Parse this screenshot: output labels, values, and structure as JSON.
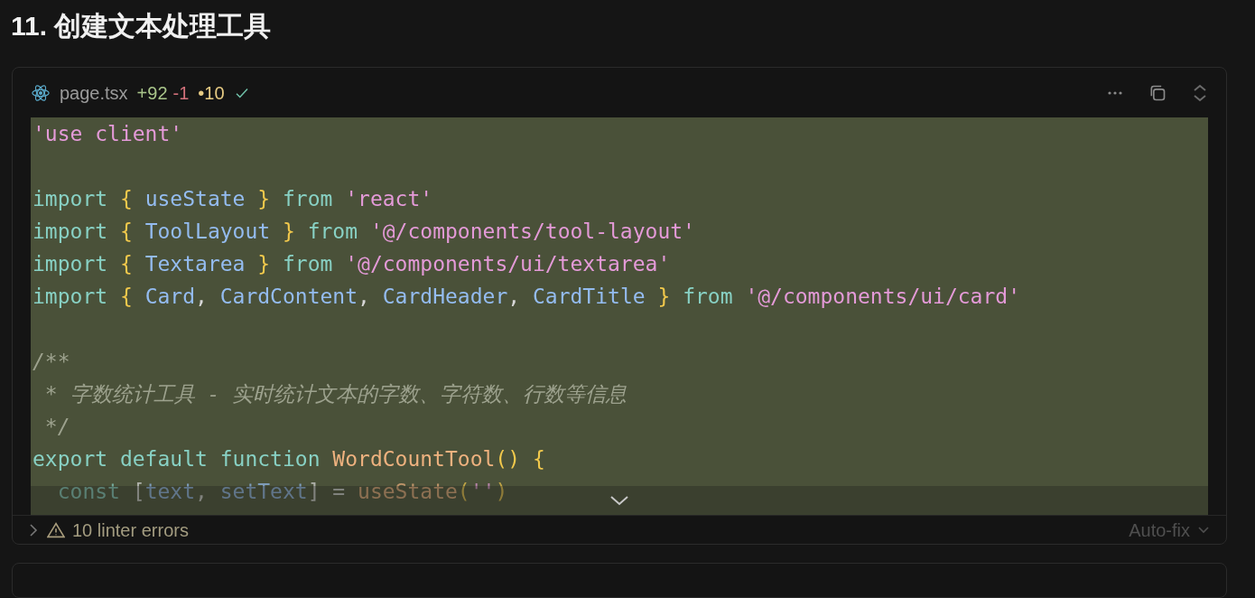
{
  "heading": "11. 创建文本处理工具",
  "file": {
    "name": "page.tsx",
    "added": "+92",
    "removed": "-1",
    "changes": "•10"
  },
  "code": {
    "lines": [
      {
        "kind": "code",
        "tokens": [
          {
            "kind": "string",
            "text": "'use client'"
          }
        ]
      },
      {
        "kind": "blank"
      },
      {
        "kind": "code",
        "tokens": [
          {
            "kind": "keyword",
            "text": "import "
          },
          {
            "kind": "brace",
            "text": "{ "
          },
          {
            "kind": "ident",
            "text": "useState"
          },
          {
            "kind": "brace",
            "text": " }"
          },
          {
            "kind": "keyword",
            "text": " from "
          },
          {
            "kind": "string",
            "text": "'react'"
          }
        ]
      },
      {
        "kind": "code",
        "tokens": [
          {
            "kind": "keyword",
            "text": "import "
          },
          {
            "kind": "brace",
            "text": "{ "
          },
          {
            "kind": "ident",
            "text": "ToolLayout"
          },
          {
            "kind": "brace",
            "text": " }"
          },
          {
            "kind": "keyword",
            "text": " from "
          },
          {
            "kind": "string",
            "text": "'@/components/tool-layout'"
          }
        ]
      },
      {
        "kind": "code",
        "tokens": [
          {
            "kind": "keyword",
            "text": "import "
          },
          {
            "kind": "brace",
            "text": "{ "
          },
          {
            "kind": "ident",
            "text": "Textarea"
          },
          {
            "kind": "brace",
            "text": " }"
          },
          {
            "kind": "keyword",
            "text": " from "
          },
          {
            "kind": "string",
            "text": "'@/components/ui/textarea'"
          }
        ]
      },
      {
        "kind": "code",
        "tokens": [
          {
            "kind": "keyword",
            "text": "import "
          },
          {
            "kind": "brace",
            "text": "{ "
          },
          {
            "kind": "ident",
            "text": "Card"
          },
          {
            "kind": "plain",
            "text": ", "
          },
          {
            "kind": "ident",
            "text": "CardContent"
          },
          {
            "kind": "plain",
            "text": ", "
          },
          {
            "kind": "ident",
            "text": "CardHeader"
          },
          {
            "kind": "plain",
            "text": ", "
          },
          {
            "kind": "ident",
            "text": "CardTitle"
          },
          {
            "kind": "brace",
            "text": " }"
          },
          {
            "kind": "keyword",
            "text": " from "
          },
          {
            "kind": "string",
            "text": "'@/components/ui/card'"
          }
        ]
      },
      {
        "kind": "blank"
      },
      {
        "kind": "code",
        "tokens": [
          {
            "kind": "comment",
            "text": "/**"
          }
        ]
      },
      {
        "kind": "code",
        "tokens": [
          {
            "kind": "comment",
            "text": " * 字数统计工具 - 实时统计文本的字数、字符数、行数等信息"
          }
        ]
      },
      {
        "kind": "code",
        "tokens": [
          {
            "kind": "comment",
            "text": " */"
          }
        ]
      },
      {
        "kind": "code",
        "tokens": [
          {
            "kind": "keyword",
            "text": "export default function "
          },
          {
            "kind": "func",
            "text": "WordCountTool"
          },
          {
            "kind": "brace",
            "text": "() {"
          }
        ]
      },
      {
        "kind": "code",
        "faded": true,
        "tokens": [
          {
            "kind": "keyword",
            "text": "  const "
          },
          {
            "kind": "plain",
            "text": "["
          },
          {
            "kind": "ident",
            "text": "text"
          },
          {
            "kind": "plain",
            "text": ", "
          },
          {
            "kind": "ident",
            "text": "setText"
          },
          {
            "kind": "plain",
            "text": "] = "
          },
          {
            "kind": "func",
            "text": "useState"
          },
          {
            "kind": "brace",
            "text": "("
          },
          {
            "kind": "string",
            "text": "''"
          },
          {
            "kind": "brace",
            "text": ")"
          }
        ]
      }
    ]
  },
  "footer": {
    "errors": "10 linter errors",
    "action": "Auto-fix"
  }
}
